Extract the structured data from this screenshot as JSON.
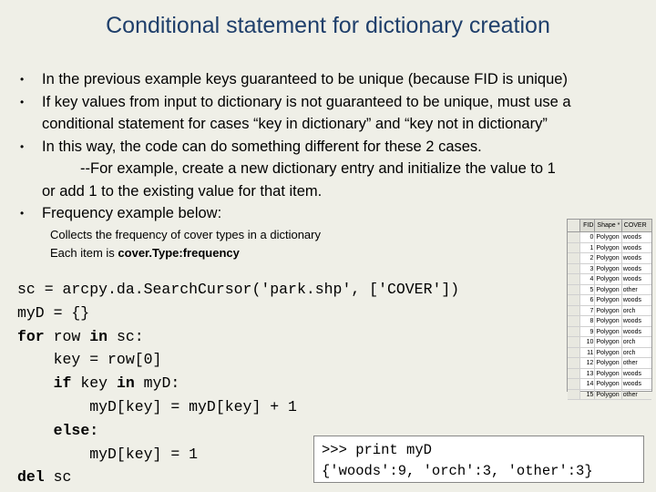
{
  "title": "Conditional statement for dictionary creation",
  "bullets": [
    {
      "dot": "•",
      "lines": [
        "In the previous example keys guaranteed to be unique (because FID is unique)"
      ]
    },
    {
      "dot": "•",
      "lines": [
        "If key values from input to dictionary is not guaranteed to be unique, must use a",
        "conditional statement for cases “key in dictionary” and “key not in dictionary”"
      ]
    },
    {
      "dot": "•",
      "lines": [
        "In this way, the code can do something different for these 2 cases.",
        "--For example, create a new dictionary entry and initialize the value to 1",
        "or add 1 to  the existing value for that item."
      ]
    },
    {
      "dot": "•",
      "lines": [
        "Frequency example below:"
      ]
    }
  ],
  "subtext": {
    "line1": "Collects the frequency of cover types in a dictionary",
    "line2_prefix": "Each item is ",
    "line2_bold": "cover.Type:frequency"
  },
  "code": {
    "l1": "sc = arcpy.da.SearchCursor('park.shp', ['COVER'])",
    "l2": "myD = {}",
    "l3_kw1": "for",
    "l3_mid": " row ",
    "l3_kw2": "in",
    "l3_end": " sc:",
    "l4": "    key = row[0]",
    "l5_kw1": "if",
    "l5_mid": " key ",
    "l5_kw2": "in",
    "l5_end": " myD:",
    "l6": "        myD[key] = myD[key] + 1",
    "l7_kw": "else:",
    "l8": "        myD[key] = 1",
    "l9_kw": "del",
    "l9_end": " sc"
  },
  "output": {
    "line1": ">>> print myD",
    "line2": "{'woods':9, 'orch':3, 'other':3}"
  },
  "table": {
    "headers": [
      "",
      "FID",
      "Shape *",
      "COVER"
    ],
    "rows": [
      [
        "",
        "0",
        "Polygon",
        "woods"
      ],
      [
        "",
        "1",
        "Polygon",
        "woods"
      ],
      [
        "",
        "2",
        "Polygon",
        "woods"
      ],
      [
        "",
        "3",
        "Polygon",
        "woods"
      ],
      [
        "",
        "4",
        "Polygon",
        "woods"
      ],
      [
        "",
        "5",
        "Polygon",
        "other"
      ],
      [
        "",
        "6",
        "Polygon",
        "woods"
      ],
      [
        "",
        "7",
        "Polygon",
        "orch"
      ],
      [
        "",
        "8",
        "Polygon",
        "woods"
      ],
      [
        "",
        "9",
        "Polygon",
        "woods"
      ],
      [
        "",
        "10",
        "Polygon",
        "orch"
      ],
      [
        "",
        "11",
        "Polygon",
        "orch"
      ],
      [
        "",
        "12",
        "Polygon",
        "other"
      ],
      [
        "",
        "13",
        "Polygon",
        "woods"
      ],
      [
        "",
        "14",
        "Polygon",
        "woods"
      ],
      [
        "",
        "15",
        "Polygon",
        "other"
      ]
    ]
  }
}
